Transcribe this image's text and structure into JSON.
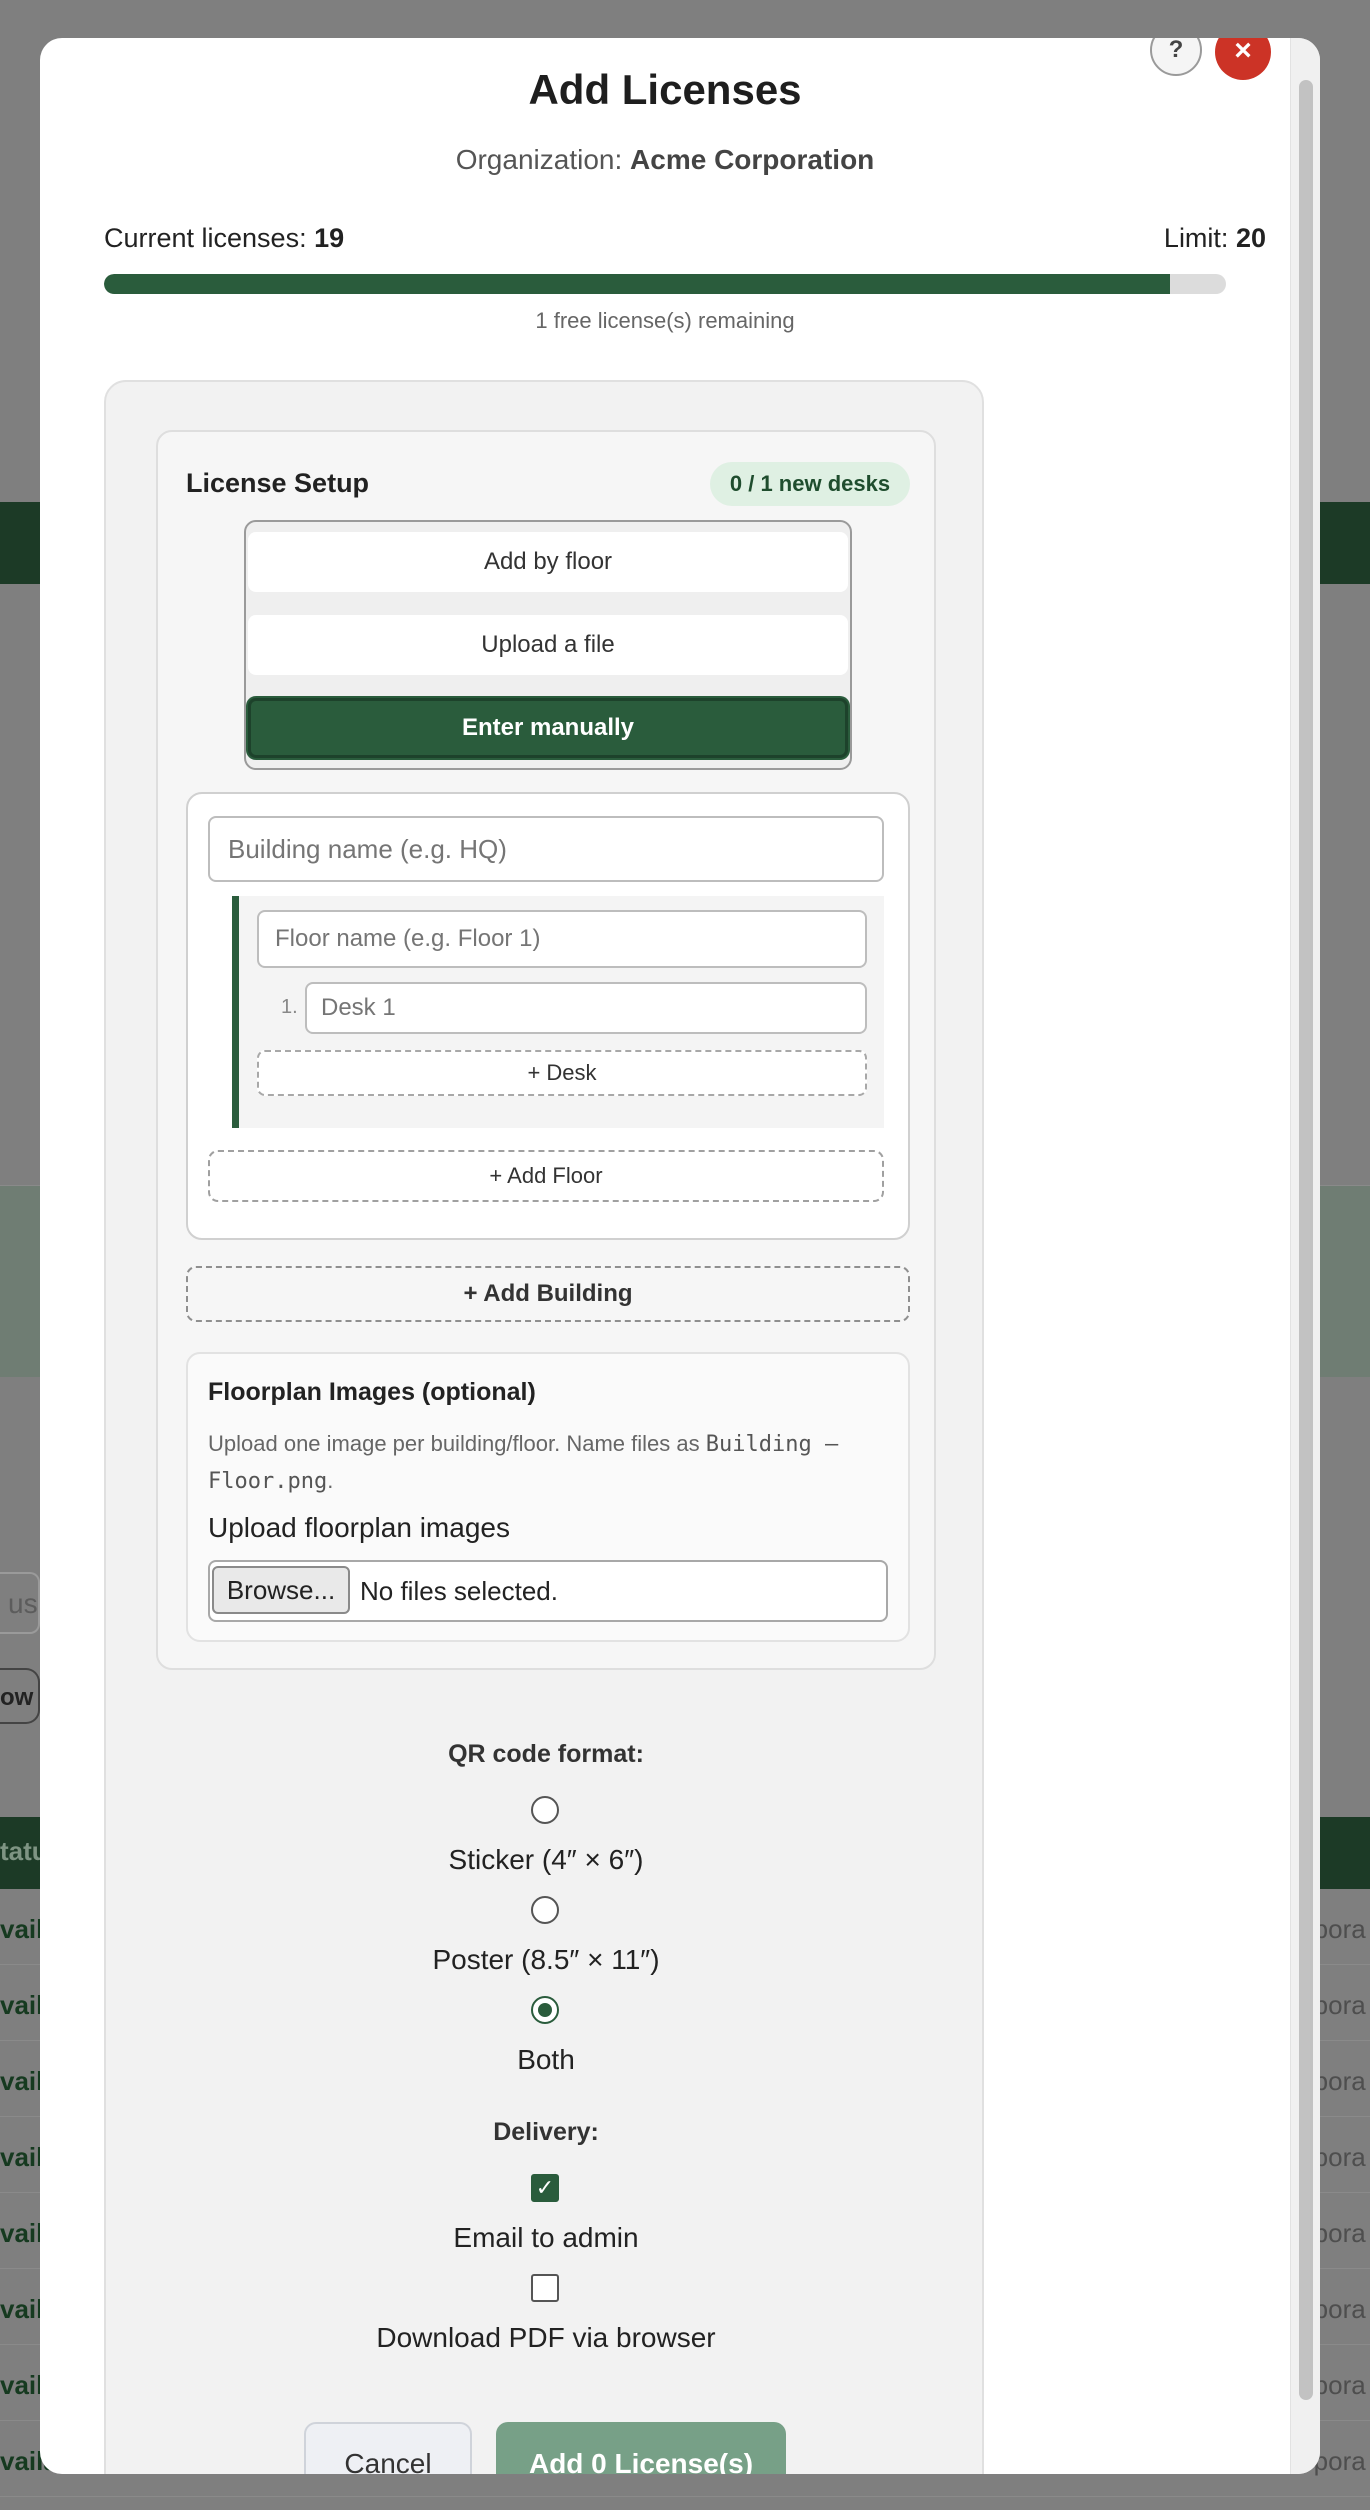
{
  "modal": {
    "title": "Add Licenses",
    "help_icon": "?",
    "close_icon": "×",
    "organization_label": "Organization:",
    "organization_name": "Acme Corporation"
  },
  "licenses": {
    "current_label": "Current licenses:",
    "current_value": "19",
    "limit_label": "Limit:",
    "limit_value": "20",
    "progress_percent": 95,
    "remaining_text": "1 free license(s) remaining"
  },
  "setup": {
    "title": "License Setup",
    "badge": "0 / 1 new desks",
    "methods": [
      "Add by floor",
      "Upload a file",
      "Enter manually"
    ],
    "active_method": "Enter manually",
    "building_placeholder": "Building name (e.g. HQ)",
    "floor_placeholder": "Floor name (e.g. Floor 1)",
    "desk_number": "1.",
    "desk_placeholder": "Desk 1",
    "add_desk": "+ Desk",
    "add_floor": "+ Add Floor",
    "add_building": "+ Add Building"
  },
  "floorplan": {
    "title": "Floorplan Images (optional)",
    "help_text": "Upload one image per building/floor. Name files as",
    "help_code": "Building – Floor.png",
    "help_suffix": ".",
    "upload_label": "Upload floorplan images",
    "browse_label": "Browse...",
    "file_status": "No files selected."
  },
  "qr": {
    "heading": "QR code format:",
    "options": [
      "Sticker (4″ × 6″)",
      "Poster (8.5″ × 11″)",
      "Both"
    ],
    "selected": "Both"
  },
  "delivery": {
    "heading": "Delivery:",
    "options": [
      {
        "label": "Email to admin",
        "checked": true
      },
      {
        "label": "Download PDF via browser",
        "checked": false
      }
    ]
  },
  "actions": {
    "cancel": "Cancel",
    "submit": "Add 0 License(s)"
  },
  "background": {
    "input_fragment": "us",
    "button_fragment": "ow",
    "header_fragment": "tatu",
    "row_left_fragment": "vaila",
    "row_right_fragment": "rpora"
  },
  "colors": {
    "accent": "#2a5c3c",
    "close": "#cc3326",
    "submit_disabled": "#77a087"
  }
}
